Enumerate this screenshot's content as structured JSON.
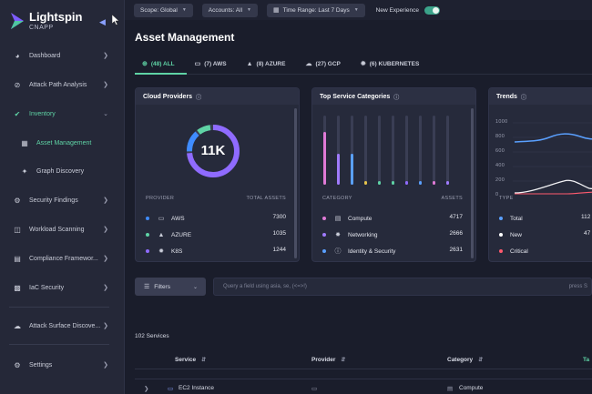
{
  "brand": {
    "name": "Lightspin",
    "sub": "CNAPP"
  },
  "topbar": {
    "scope": "Scope: Global",
    "accounts": "Accounts: All",
    "time_range": "Time Range: Last 7 Days",
    "new_experience": "New Experience",
    "new_experience_on": true
  },
  "sidebar": {
    "items": [
      {
        "label": "Dashboard",
        "icon": "dashboard-icon"
      },
      {
        "label": "Attack Path Analysis",
        "icon": "attack-path-icon"
      },
      {
        "label": "Inventory",
        "icon": "inventory-icon"
      },
      {
        "label": "Asset Management",
        "icon": "asset-icon"
      },
      {
        "label": "Graph Discovery",
        "icon": "graph-icon"
      },
      {
        "label": "Security Findings",
        "icon": "findings-icon"
      },
      {
        "label": "Workload Scanning",
        "icon": "workload-icon"
      },
      {
        "label": "Compliance Framewor...",
        "icon": "compliance-icon"
      },
      {
        "label": "IaC Security",
        "icon": "iac-icon"
      },
      {
        "label": "Attack Surface Discove...",
        "icon": "attack-surface-icon"
      },
      {
        "label": "Settings",
        "icon": "settings-icon"
      }
    ]
  },
  "main": {
    "title": "Asset Management",
    "tabs": [
      {
        "label": "(48) ALL",
        "active": true
      },
      {
        "label": "(7) AWS"
      },
      {
        "label": "(8) AZURE"
      },
      {
        "label": "(27) GCP"
      },
      {
        "label": "(6) KUBERNETES"
      }
    ]
  },
  "cloud_providers": {
    "title": "Cloud Providers",
    "total": "11K",
    "col_provider": "PROVIDER",
    "col_total": "TOTAL ASSETS",
    "rows": [
      {
        "name": "AWS",
        "value": "7300",
        "color": "#3f8cff"
      },
      {
        "name": "AZURE",
        "value": "1035",
        "color": "#5fd3a5"
      },
      {
        "name": "K8S",
        "value": "1244",
        "color": "#8f6bff"
      }
    ]
  },
  "top_services": {
    "title": "Top Service Categories",
    "col_category": "CATEGORY",
    "col_assets": "ASSETS",
    "rows": [
      {
        "name": "Compute",
        "value": "4717",
        "color": "#e07ad6"
      },
      {
        "name": "Networking",
        "value": "2666",
        "color": "#a07bff"
      },
      {
        "name": "Identity & Security",
        "value": "2631",
        "color": "#5aa0ff"
      }
    ]
  },
  "trends": {
    "title": "Trends",
    "col_type": "TYPE",
    "y_ticks": [
      "1000",
      "800",
      "600",
      "400",
      "200",
      "0"
    ],
    "rows": [
      {
        "name": "Total",
        "value": "112",
        "color": "#5aa0ff"
      },
      {
        "name": "New",
        "value": "47",
        "color": "#ffffff"
      },
      {
        "name": "Critical",
        "value": "",
        "color": "#ff5a6e"
      }
    ]
  },
  "filters": {
    "label": "Filters",
    "query_placeholder": "Query a field using asia, se, (<=>!)",
    "search_hint": "press S"
  },
  "table": {
    "count": "102 Services",
    "headers": [
      "Service",
      "Provider",
      "Category",
      "Ta"
    ],
    "rows": [
      {
        "service": "EC2 Instance",
        "category": "Compute"
      }
    ]
  },
  "colors": {
    "accent": "#5fd3a5",
    "bg": "#1a1d2b",
    "panel": "#262a3b"
  }
}
